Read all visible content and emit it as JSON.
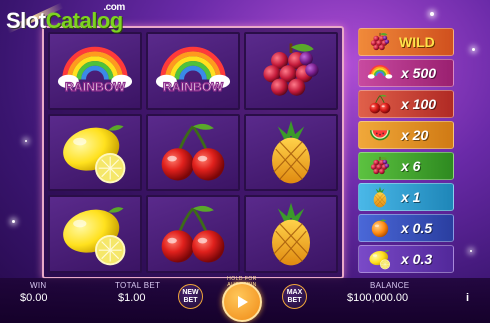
{
  "brand": {
    "logo_slot": "Slot",
    "logo_catalog": "Catalog",
    "logo_com": ".com"
  },
  "reels": {
    "rows": [
      [
        "rainbow",
        "rainbow",
        "grapes"
      ],
      [
        "lemon",
        "cherry",
        "pineapple"
      ],
      [
        "lemon",
        "cherry",
        "pineapple"
      ]
    ],
    "rainbow_text": "RAINBOW"
  },
  "paytable": [
    {
      "symbol": "wild",
      "label": "WILD",
      "bg": "#e0662a"
    },
    {
      "symbol": "rainbow",
      "label": "x 500",
      "bg": "#b8348a"
    },
    {
      "symbol": "cherry",
      "label": "x 100",
      "bg": "#d24a3c"
    },
    {
      "symbol": "watermelon",
      "label": "x 20",
      "bg": "#e89a2a"
    },
    {
      "symbol": "grapes",
      "label": "x 6",
      "bg": "#4fb237"
    },
    {
      "symbol": "pineapple",
      "label": "x 1",
      "bg": "#35a6d6"
    },
    {
      "symbol": "orange",
      "label": "x 0.5",
      "bg": "#3b58c9"
    },
    {
      "symbol": "lemon",
      "label": "x 0.3",
      "bg": "#6a3bb8"
    }
  ],
  "bottom": {
    "win_label": "WIN",
    "win_value": "$0.00",
    "total_bet_label": "TOTAL BET",
    "total_bet_value": "$1.00",
    "new_bet_label": "NEW BET",
    "spin_ring_text": "HOLD FOR AUTOSPIN",
    "max_bet_label": "MAX BET",
    "balance_label": "BALANCE",
    "balance_value": "$100,000.00",
    "info_label": "i"
  },
  "colors": {
    "accent": "#f08a16",
    "logo_green": "#7dd321"
  }
}
